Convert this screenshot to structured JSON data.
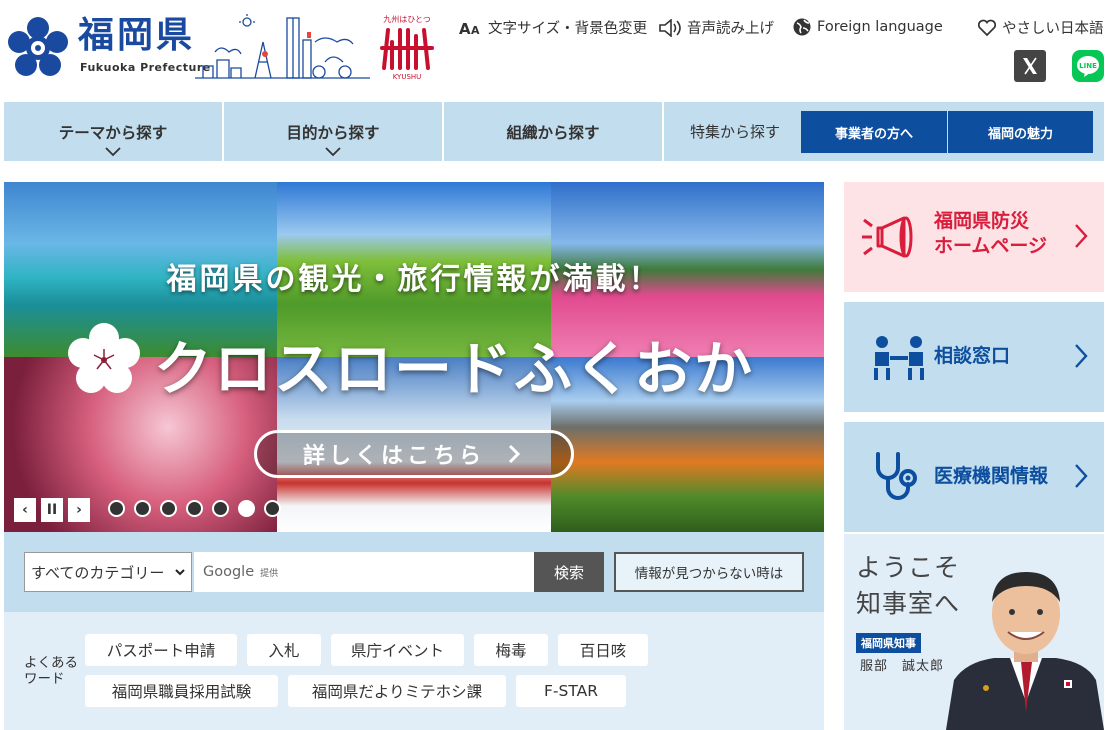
{
  "header": {
    "logo_kanji": "福岡県",
    "logo_roman": "Fukuoka Prefecture",
    "kyushu_top": "九州はひとつ",
    "kyushu_bottom": "KYUSHU",
    "utilities": [
      {
        "icon": "font-size-icon",
        "label": "文字サイズ・背景色変更"
      },
      {
        "icon": "speaker-icon",
        "label": "音声読み上げ"
      },
      {
        "icon": "globe-icon",
        "label": "Foreign language"
      },
      {
        "icon": "heart-icon",
        "label": "やさしい日本語"
      }
    ],
    "sns": [
      {
        "icon": "x-icon",
        "color": "#444444"
      },
      {
        "icon": "line-icon",
        "label": "LINE",
        "color": "#06c755"
      }
    ]
  },
  "nav": {
    "items": [
      "テーマから探す",
      "目的から探す",
      "組織から探す"
    ],
    "feature_label": "特集から探す",
    "buttons": [
      "事業者の方へ",
      "福岡の魅力"
    ]
  },
  "hero": {
    "title": "福岡県の観光・旅行情報が満載！",
    "name": "クロスロードふくおか",
    "cta": "詳しくはこちら",
    "controls": [
      "‹",
      "II",
      "›"
    ],
    "slide_count": 7,
    "active_slide": 6
  },
  "search": {
    "category": "すべてのカテゴリー",
    "placeholder_brand": "Google",
    "placeholder_suffix": "提供",
    "button": "検索",
    "not_found": "情報が見つからない時は"
  },
  "keywords": {
    "label": "よくあるワード",
    "items": [
      "パスポート申請",
      "入札",
      "県庁イベント",
      "梅毒",
      "百日咳",
      "福岡県職員採用試験",
      "福岡県だよりミテホシ課",
      "F-STAR"
    ]
  },
  "side": {
    "cards": [
      {
        "icon": "megaphone-icon",
        "label_line1": "福岡県防災",
        "label_line2": "ホームページ",
        "color": "#d81e3c"
      },
      {
        "icon": "consultation-icon",
        "label_line1": "相談窓口",
        "label_line2": "",
        "color": "#0d4f9e"
      },
      {
        "icon": "stethoscope-icon",
        "label_line1": "医療機関情報",
        "label_line2": "",
        "color": "#0d4f9e"
      }
    ],
    "governor": {
      "welcome_line1": "ようこそ",
      "welcome_line2": "知事室へ",
      "badge": "福岡県知事",
      "name": "服部　誠太郎"
    }
  }
}
